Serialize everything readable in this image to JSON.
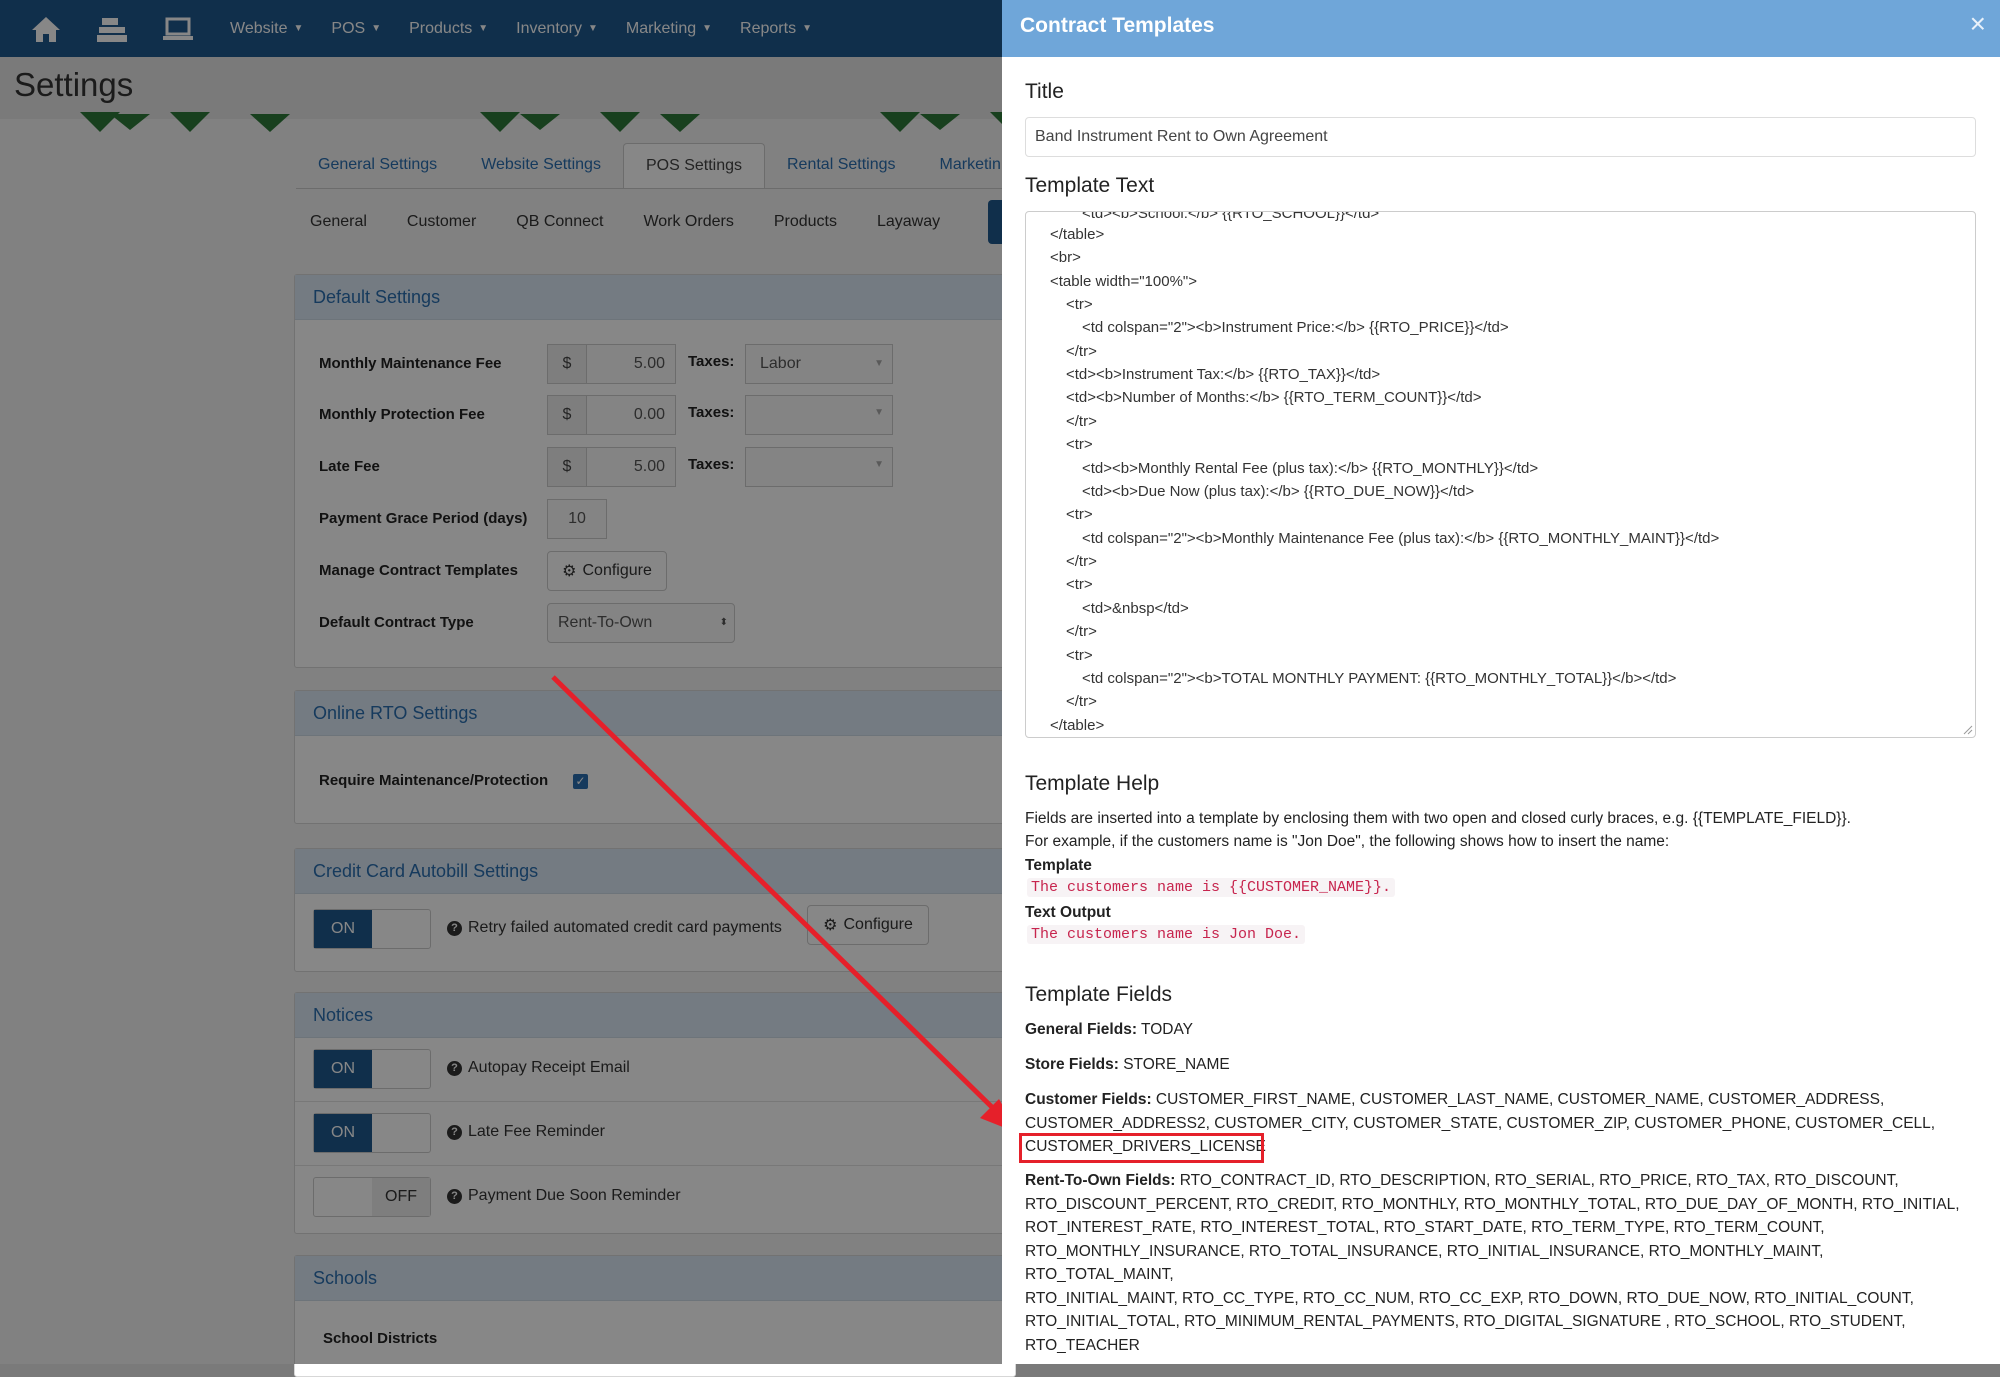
{
  "nav": {
    "icons": [
      "home-icon",
      "register-icon",
      "laptop-icon"
    ],
    "menu": [
      "Website",
      "POS",
      "Products",
      "Inventory",
      "Marketing",
      "Reports"
    ]
  },
  "page": {
    "title": "Settings"
  },
  "tabs": [
    "General Settings",
    "Website Settings",
    "POS Settings",
    "Rental Settings",
    "Marketin"
  ],
  "subtabs": [
    "General",
    "Customer",
    "QB Connect",
    "Work Orders",
    "Products",
    "Layaway"
  ],
  "default_settings": {
    "title": "Default Settings",
    "monthly_maintenance": {
      "label": "Monthly Maintenance Fee",
      "currency": "$",
      "value": "5.00",
      "taxes_label": "Taxes:",
      "taxes_value": "Labor"
    },
    "monthly_protection": {
      "label": "Monthly Protection Fee",
      "currency": "$",
      "value": "0.00",
      "taxes_label": "Taxes:",
      "taxes_value": ""
    },
    "late_fee": {
      "label": "Late Fee",
      "currency": "$",
      "value": "5.00",
      "taxes_label": "Taxes:",
      "taxes_value": ""
    },
    "grace_period": {
      "label": "Payment Grace Period (days)",
      "value": "10"
    },
    "contract_templates": {
      "label": "Manage Contract Templates",
      "button": "Configure"
    },
    "contract_type": {
      "label": "Default Contract Type",
      "value": "Rent-To-Own"
    }
  },
  "online_rto": {
    "title": "Online RTO Settings",
    "require_label": "Require Maintenance/Protection",
    "checked": true
  },
  "autobill": {
    "title": "Credit Card Autobill Settings",
    "toggle": "ON",
    "label": "Retry failed automated credit card payments",
    "button": "Configure"
  },
  "notices": {
    "title": "Notices",
    "items": [
      {
        "toggle": "ON",
        "label": "Autopay Receipt Email"
      },
      {
        "toggle": "ON",
        "label": "Late Fee Reminder"
      },
      {
        "toggle": "OFF",
        "label": "Payment Due Soon Reminder"
      }
    ]
  },
  "schools": {
    "title": "Schools",
    "districts_label": "School Districts"
  },
  "modal": {
    "title": "Contract Templates",
    "close": "×",
    "title_label": "Title",
    "title_value": "Band Instrument Rent to Own Agreement",
    "text_label": "Template Text",
    "code_lines": [
      "<td><b>School:</b> {{RTO_SCHOOL}}</td>",
      "</table>",
      "<br>",
      "<table width=\"100%\">",
      "<tr>",
      "<td colspan=\"2\"><b>Instrument Price:</b> {{RTO_PRICE}}</td>",
      "</tr>",
      "<td><b>Instrument Tax:</b> {{RTO_TAX}}</td>",
      "<td><b>Number of Months:</b> {{RTO_TERM_COUNT}}</td>",
      "</tr>",
      "<tr>",
      "<td><b>Monthly Rental Fee (plus tax):</b> {{RTO_MONTHLY}}</td>",
      "<td><b>Due Now (plus tax):</b> {{RTO_DUE_NOW}}</td>",
      "<tr>",
      "<td colspan=\"2\"><b>Monthly Maintenance Fee (plus tax):</b> {{RTO_MONTHLY_MAINT}}</td>",
      "</tr>",
      "<tr>",
      "<td>&nbsp</td>",
      "</tr>",
      "<tr>",
      "<td colspan=\"2\"><b>TOTAL MONTHLY PAYMENT: {{RTO_MONTHLY_TOTAL}}</b></td>",
      "</tr>",
      "</table>"
    ],
    "help": {
      "title": "Template Help",
      "line1": "Fields are inserted into a template by enclosing them with two open and closed curly braces, e.g. {{TEMPLATE_FIELD}}.",
      "line2": "For example, if the customers name is \"Jon Doe\", the following shows how to insert the name:",
      "template_label": "Template",
      "template_code": "The customers name is {{CUSTOMER_NAME}}.",
      "output_label": "Text Output",
      "output_code": "The customers name is Jon Doe."
    },
    "fields": {
      "title": "Template Fields",
      "general_label": "General Fields:",
      "general": "TODAY",
      "store_label": "Store Fields:",
      "store": "STORE_NAME",
      "customer_label": "Customer Fields:",
      "customer_line1": "CUSTOMER_FIRST_NAME, CUSTOMER_LAST_NAME, CUSTOMER_NAME, CUSTOMER_ADDRESS,",
      "customer_line2": "CUSTOMER_ADDRESS2, CUSTOMER_CITY, CUSTOMER_STATE, CUSTOMER_ZIP, CUSTOMER_PHONE, CUSTOMER_CELL,",
      "customer_line3": "CUSTOMER_DRIVERS_LICENSE",
      "rto_label": "Rent-To-Own Fields:",
      "rto_line1": "RTO_CONTRACT_ID, RTO_DESCRIPTION, RTO_SERIAL, RTO_PRICE, RTO_TAX, RTO_DISCOUNT,",
      "rto_line2": "RTO_DISCOUNT_PERCENT, RTO_CREDIT, RTO_MONTHLY, RTO_MONTHLY_TOTAL, RTO_DUE_DAY_OF_MONTH, RTO_INITIAL,",
      "rto_line3": "ROT_INTEREST_RATE, RTO_INTEREST_TOTAL, RTO_START_DATE, RTO_TERM_TYPE, RTO_TERM_COUNT,",
      "rto_line4": "RTO_MONTHLY_INSURANCE, RTO_TOTAL_INSURANCE, RTO_INITIAL_INSURANCE, RTO_MONTHLY_MAINT, RTO_TOTAL_MAINT,",
      "rto_line5": "RTO_INITIAL_MAINT, RTO_CC_TYPE, RTO_CC_NUM, RTO_CC_EXP, RTO_DOWN, RTO_DUE_NOW, RTO_INITIAL_COUNT,",
      "rto_line6": "RTO_INITIAL_TOTAL, RTO_MINIMUM_RENTAL_PAYMENTS, RTO_DIGITAL_SIGNATURE , RTO_SCHOOL, RTO_STUDENT,",
      "rto_line7": "RTO_TEACHER"
    }
  },
  "annotation": {
    "color": "#e5202a"
  }
}
